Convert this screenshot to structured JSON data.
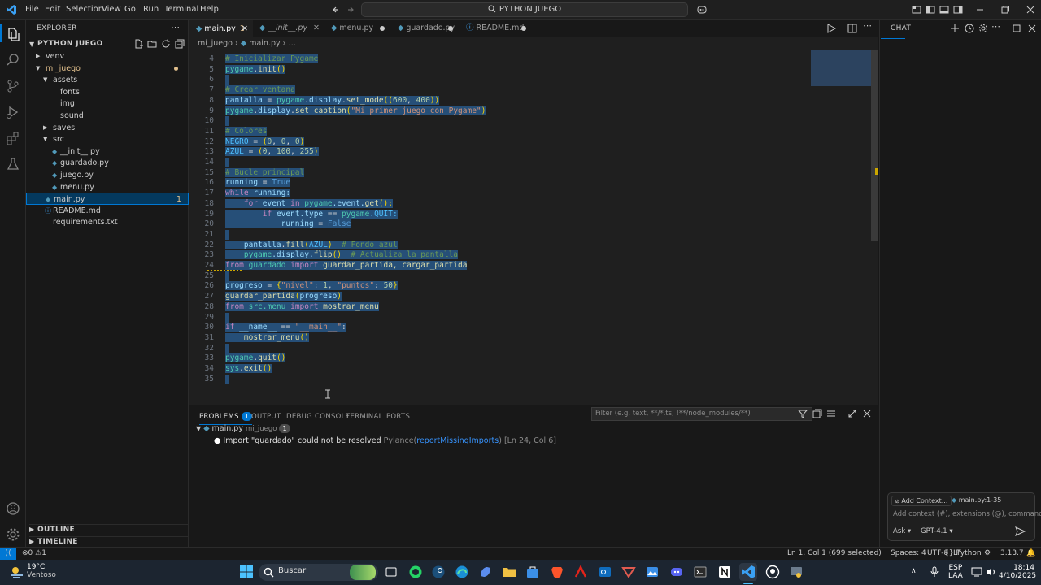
{
  "titlebar": {
    "menus": [
      "File",
      "Edit",
      "Selection",
      "View",
      "Go",
      "Run",
      "Terminal",
      "Help"
    ],
    "search": "PYTHON JUEGO"
  },
  "explorer": {
    "title": "EXPLORER",
    "project": "PYTHON JUEGO",
    "tree": [
      {
        "label": "venv",
        "indent": 0,
        "kind": "folder-closed"
      },
      {
        "label": "mi_juego",
        "indent": 0,
        "kind": "folder-open",
        "modified": true
      },
      {
        "label": "assets",
        "indent": 1,
        "kind": "folder-open"
      },
      {
        "label": "fonts",
        "indent": 2,
        "kind": "plain"
      },
      {
        "label": "img",
        "indent": 2,
        "kind": "plain"
      },
      {
        "label": "sound",
        "indent": 2,
        "kind": "plain"
      },
      {
        "label": "saves",
        "indent": 1,
        "kind": "folder-closed"
      },
      {
        "label": "src",
        "indent": 1,
        "kind": "folder-open"
      },
      {
        "label": "__init__.py",
        "indent": 2,
        "kind": "py"
      },
      {
        "label": "guardado.py",
        "indent": 2,
        "kind": "py"
      },
      {
        "label": "juego.py",
        "indent": 2,
        "kind": "py"
      },
      {
        "label": "menu.py",
        "indent": 2,
        "kind": "py"
      },
      {
        "label": "main.py",
        "indent": 1,
        "kind": "py",
        "selected": true,
        "count": "1"
      },
      {
        "label": "README.md",
        "indent": 1,
        "kind": "md"
      },
      {
        "label": "requirements.txt",
        "indent": 1,
        "kind": "txt"
      }
    ],
    "outline": "OUTLINE",
    "timeline": "TIMELINE"
  },
  "tabs": [
    {
      "label": "main.py",
      "badge": "1",
      "active": true
    },
    {
      "label": "__init__.py",
      "italic": true
    },
    {
      "label": "menu.py",
      "dirty": true
    },
    {
      "label": "guardado.py",
      "dirty": true
    },
    {
      "label": "README.md",
      "dirty": true
    }
  ],
  "breadcrumb": {
    "folder": "mi_juego",
    "file": "main.py"
  },
  "code": [
    {
      "n": "4",
      "t": [
        [
          "# Inicializar Pygame",
          "#6a9955"
        ]
      ]
    },
    {
      "n": "5",
      "t": [
        [
          "pygame",
          "#4ec9b0"
        ],
        [
          ".",
          "#d4d4d4"
        ],
        [
          "init",
          "#dcdcaa"
        ],
        [
          "()",
          "#ffd700"
        ]
      ]
    },
    {
      "n": "6",
      "t": []
    },
    {
      "n": "7",
      "t": [
        [
          "# Crear ventana",
          "#6a9955"
        ]
      ]
    },
    {
      "n": "8",
      "t": [
        [
          "pantalla",
          "#9cdcfe"
        ],
        [
          " = ",
          "#d4d4d4"
        ],
        [
          "pygame",
          "#4ec9b0"
        ],
        [
          ".",
          "#d4d4d4"
        ],
        [
          "display",
          "#9cdcfe"
        ],
        [
          ".",
          "#d4d4d4"
        ],
        [
          "set_mode",
          "#dcdcaa"
        ],
        [
          "((",
          "#ffd700"
        ],
        [
          "600",
          "#b5cea8"
        ],
        [
          ", ",
          "#d4d4d4"
        ],
        [
          "400",
          "#b5cea8"
        ],
        [
          "))",
          "#ffd700"
        ]
      ]
    },
    {
      "n": "9",
      "t": [
        [
          "pygame",
          "#4ec9b0"
        ],
        [
          ".",
          "#d4d4d4"
        ],
        [
          "display",
          "#9cdcfe"
        ],
        [
          ".",
          "#d4d4d4"
        ],
        [
          "set_caption",
          "#dcdcaa"
        ],
        [
          "(",
          "#ffd700"
        ],
        [
          "\"Mi primer juego con Pygame\"",
          "#ce9178"
        ],
        [
          ")",
          "#ffd700"
        ]
      ]
    },
    {
      "n": "10",
      "t": []
    },
    {
      "n": "11",
      "t": [
        [
          "# Colores",
          "#6a9955"
        ]
      ]
    },
    {
      "n": "12",
      "t": [
        [
          "NEGRO",
          "#4fc1ff"
        ],
        [
          " = ",
          "#d4d4d4"
        ],
        [
          "(",
          "#ffd700"
        ],
        [
          "0",
          "#b5cea8"
        ],
        [
          ", ",
          "#d4d4d4"
        ],
        [
          "0",
          "#b5cea8"
        ],
        [
          ", ",
          "#d4d4d4"
        ],
        [
          "0",
          "#b5cea8"
        ],
        [
          ")",
          "#ffd700"
        ]
      ]
    },
    {
      "n": "13",
      "t": [
        [
          "AZUL",
          "#4fc1ff"
        ],
        [
          " = ",
          "#d4d4d4"
        ],
        [
          "(",
          "#ffd700"
        ],
        [
          "0",
          "#b5cea8"
        ],
        [
          ", ",
          "#d4d4d4"
        ],
        [
          "100",
          "#b5cea8"
        ],
        [
          ", ",
          "#d4d4d4"
        ],
        [
          "255",
          "#b5cea8"
        ],
        [
          ")",
          "#ffd700"
        ]
      ]
    },
    {
      "n": "14",
      "t": []
    },
    {
      "n": "15",
      "t": [
        [
          "# Bucle principal",
          "#6a9955"
        ]
      ]
    },
    {
      "n": "16",
      "t": [
        [
          "running",
          "#9cdcfe"
        ],
        [
          " = ",
          "#d4d4d4"
        ],
        [
          "True",
          "#569cd6"
        ]
      ]
    },
    {
      "n": "17",
      "t": [
        [
          "while",
          "#c586c0"
        ],
        [
          " running:",
          "#9cdcfe"
        ]
      ]
    },
    {
      "n": "18",
      "t": [
        [
          "    ",
          "#d4d4d4"
        ],
        [
          "for",
          "#c586c0"
        ],
        [
          " event ",
          "#9cdcfe"
        ],
        [
          "in",
          "#c586c0"
        ],
        [
          " pygame",
          "#4ec9b0"
        ],
        [
          ".event.",
          "#9cdcfe"
        ],
        [
          "get",
          "#dcdcaa"
        ],
        [
          "():",
          "#ffd700"
        ]
      ]
    },
    {
      "n": "19",
      "t": [
        [
          "        ",
          "#d4d4d4"
        ],
        [
          "if",
          "#c586c0"
        ],
        [
          " event.type ",
          "#9cdcfe"
        ],
        [
          "==",
          "#d4d4d4"
        ],
        [
          " pygame",
          "#4ec9b0"
        ],
        [
          ".QUIT:",
          "#4fc1ff"
        ]
      ]
    },
    {
      "n": "20",
      "t": [
        [
          "            running",
          "#9cdcfe"
        ],
        [
          " = ",
          "#d4d4d4"
        ],
        [
          "False",
          "#569cd6"
        ]
      ]
    },
    {
      "n": "21",
      "t": []
    },
    {
      "n": "22",
      "t": [
        [
          "    pantalla",
          "#9cdcfe"
        ],
        [
          ".",
          "#d4d4d4"
        ],
        [
          "fill",
          "#dcdcaa"
        ],
        [
          "(",
          "#ffd700"
        ],
        [
          "AZUL",
          "#4fc1ff"
        ],
        [
          ")",
          "#ffd700"
        ],
        [
          "  # Fondo azul",
          "#6a9955"
        ]
      ]
    },
    {
      "n": "23",
      "t": [
        [
          "    pygame",
          "#4ec9b0"
        ],
        [
          ".display.",
          "#9cdcfe"
        ],
        [
          "flip",
          "#dcdcaa"
        ],
        [
          "()",
          "#ffd700"
        ],
        [
          "  # Actualiza la pantalla",
          "#6a9955"
        ]
      ]
    },
    {
      "n": "24",
      "t": [
        [
          "from",
          "#c586c0"
        ],
        [
          " guardado ",
          "#4ec9b0"
        ],
        [
          "import",
          "#c586c0"
        ],
        [
          " guardar_partida, cargar_partida",
          "#dcdcaa"
        ]
      ]
    },
    {
      "n": "25",
      "t": []
    },
    {
      "n": "26",
      "t": [
        [
          "progreso",
          "#9cdcfe"
        ],
        [
          " = ",
          "#d4d4d4"
        ],
        [
          "{",
          "#ffd700"
        ],
        [
          "\"nivel\"",
          "#ce9178"
        ],
        [
          ": ",
          "#d4d4d4"
        ],
        [
          "1",
          "#b5cea8"
        ],
        [
          ", ",
          "#d4d4d4"
        ],
        [
          "\"puntos\"",
          "#ce9178"
        ],
        [
          ": ",
          "#d4d4d4"
        ],
        [
          "50",
          "#b5cea8"
        ],
        [
          "}",
          "#ffd700"
        ]
      ]
    },
    {
      "n": "27",
      "t": [
        [
          "guardar_partida",
          "#dcdcaa"
        ],
        [
          "(",
          "#ffd700"
        ],
        [
          "progreso",
          "#9cdcfe"
        ],
        [
          ")",
          "#ffd700"
        ]
      ]
    },
    {
      "n": "28",
      "t": [
        [
          "from",
          "#c586c0"
        ],
        [
          " src.menu ",
          "#4ec9b0"
        ],
        [
          "import",
          "#c586c0"
        ],
        [
          " mostrar_menu",
          "#dcdcaa"
        ]
      ]
    },
    {
      "n": "29",
      "t": []
    },
    {
      "n": "30",
      "t": [
        [
          "if",
          "#c586c0"
        ],
        [
          " __name__ ",
          "#9cdcfe"
        ],
        [
          "==",
          "#d4d4d4"
        ],
        [
          " \"__main__\"",
          "#ce9178"
        ],
        [
          ":",
          "#d4d4d4"
        ]
      ]
    },
    {
      "n": "31",
      "t": [
        [
          "    mostrar_menu",
          "#dcdcaa"
        ],
        [
          "()",
          "#ffd700"
        ]
      ]
    },
    {
      "n": "32",
      "t": []
    },
    {
      "n": "33",
      "t": [
        [
          "pygame",
          "#4ec9b0"
        ],
        [
          ".",
          "#d4d4d4"
        ],
        [
          "quit",
          "#dcdcaa"
        ],
        [
          "()",
          "#ffd700"
        ]
      ]
    },
    {
      "n": "34",
      "t": [
        [
          "sys",
          "#4ec9b0"
        ],
        [
          ".",
          "#d4d4d4"
        ],
        [
          "exit",
          "#dcdcaa"
        ],
        [
          "()",
          "#ffd700"
        ]
      ]
    },
    {
      "n": "35",
      "t": []
    }
  ],
  "panel": {
    "tabs": [
      {
        "label": "PROBLEMS",
        "badge": "1",
        "active": true
      },
      {
        "label": "OUTPUT"
      },
      {
        "label": "DEBUG CONSOLE"
      },
      {
        "label": "TERMINAL"
      },
      {
        "label": "PORTS"
      }
    ],
    "filter_placeholder": "Filter (e.g. text, **/*.ts, !**/node_modules/**)",
    "file": "main.py",
    "folder": "mi_juego",
    "count": "1",
    "message": "Import \"guardado\" could not be resolved",
    "source": "Pylance",
    "code": "reportMissingImports",
    "location": "[Ln 24, Col 6]"
  },
  "chat": {
    "title": "CHAT",
    "add_context": "Add Context...",
    "context_file": "main.py:1-35",
    "input_placeholder": "Add context (#), extensions (@), commands",
    "mode": "Ask",
    "model": "GPT-4.1"
  },
  "status": {
    "errors": "0",
    "warnings": "1",
    "position": "Ln 1, Col 1 (699 selected)",
    "spaces": "Spaces: 4",
    "encoding": "UTF-8",
    "eol": "LF",
    "language": "Python",
    "version": "3.13.7"
  },
  "taskbar": {
    "temp": "19°C",
    "weather": "Ventoso",
    "search": "Buscar",
    "lang": "ESP",
    "lang2": "LAA",
    "time": "18:14",
    "date": "4/10/2025"
  }
}
